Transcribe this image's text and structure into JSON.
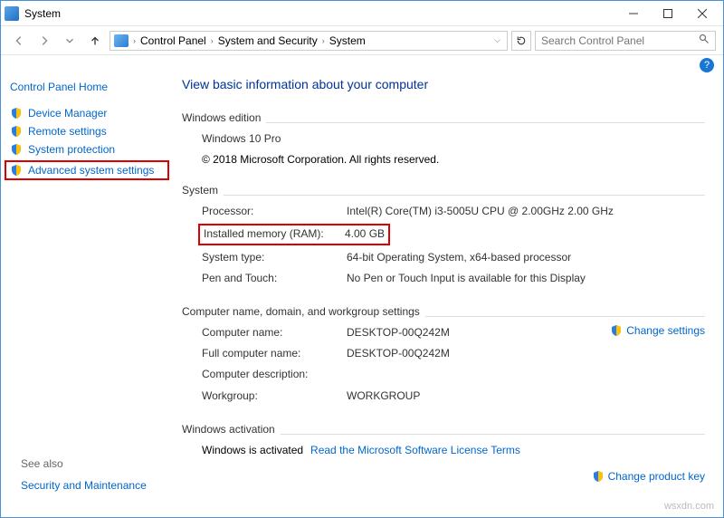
{
  "window": {
    "title": "System"
  },
  "nav": {
    "path_segments": [
      "Control Panel",
      "System and Security",
      "System"
    ],
    "search_placeholder": "Search Control Panel"
  },
  "sidebar": {
    "cp_home": "Control Panel Home",
    "links": [
      {
        "label": "Device Manager"
      },
      {
        "label": "Remote settings"
      },
      {
        "label": "System protection"
      },
      {
        "label": "Advanced system settings",
        "highlight": true
      }
    ],
    "see_also_header": "See also",
    "see_also_link": "Security and Maintenance"
  },
  "main": {
    "heading": "View basic information about your computer",
    "windows_edition": {
      "title": "Windows edition",
      "product": "Windows 10 Pro",
      "copyright": "© 2018 Microsoft Corporation. All rights reserved."
    },
    "system": {
      "title": "System",
      "rows": [
        {
          "k": "Processor:",
          "v": "Intel(R) Core(TM) i3-5005U CPU @ 2.00GHz   2.00 GHz"
        },
        {
          "k": "Installed memory (RAM):",
          "v": "4.00 GB",
          "highlight": true
        },
        {
          "k": "System type:",
          "v": "64-bit Operating System, x64-based processor"
        },
        {
          "k": "Pen and Touch:",
          "v": "No Pen or Touch Input is available for this Display"
        }
      ]
    },
    "naming": {
      "title": "Computer name, domain, and workgroup settings",
      "change_link": "Change settings",
      "rows": [
        {
          "k": "Computer name:",
          "v": "DESKTOP-00Q242M"
        },
        {
          "k": "Full computer name:",
          "v": "DESKTOP-00Q242M"
        },
        {
          "k": "Computer description:",
          "v": ""
        },
        {
          "k": "Workgroup:",
          "v": "WORKGROUP"
        }
      ]
    },
    "activation": {
      "title": "Windows activation",
      "status": "Windows is activated",
      "link": "Read the Microsoft Software License Terms",
      "change_key": "Change product key"
    }
  },
  "watermark": "wsxdn.com"
}
